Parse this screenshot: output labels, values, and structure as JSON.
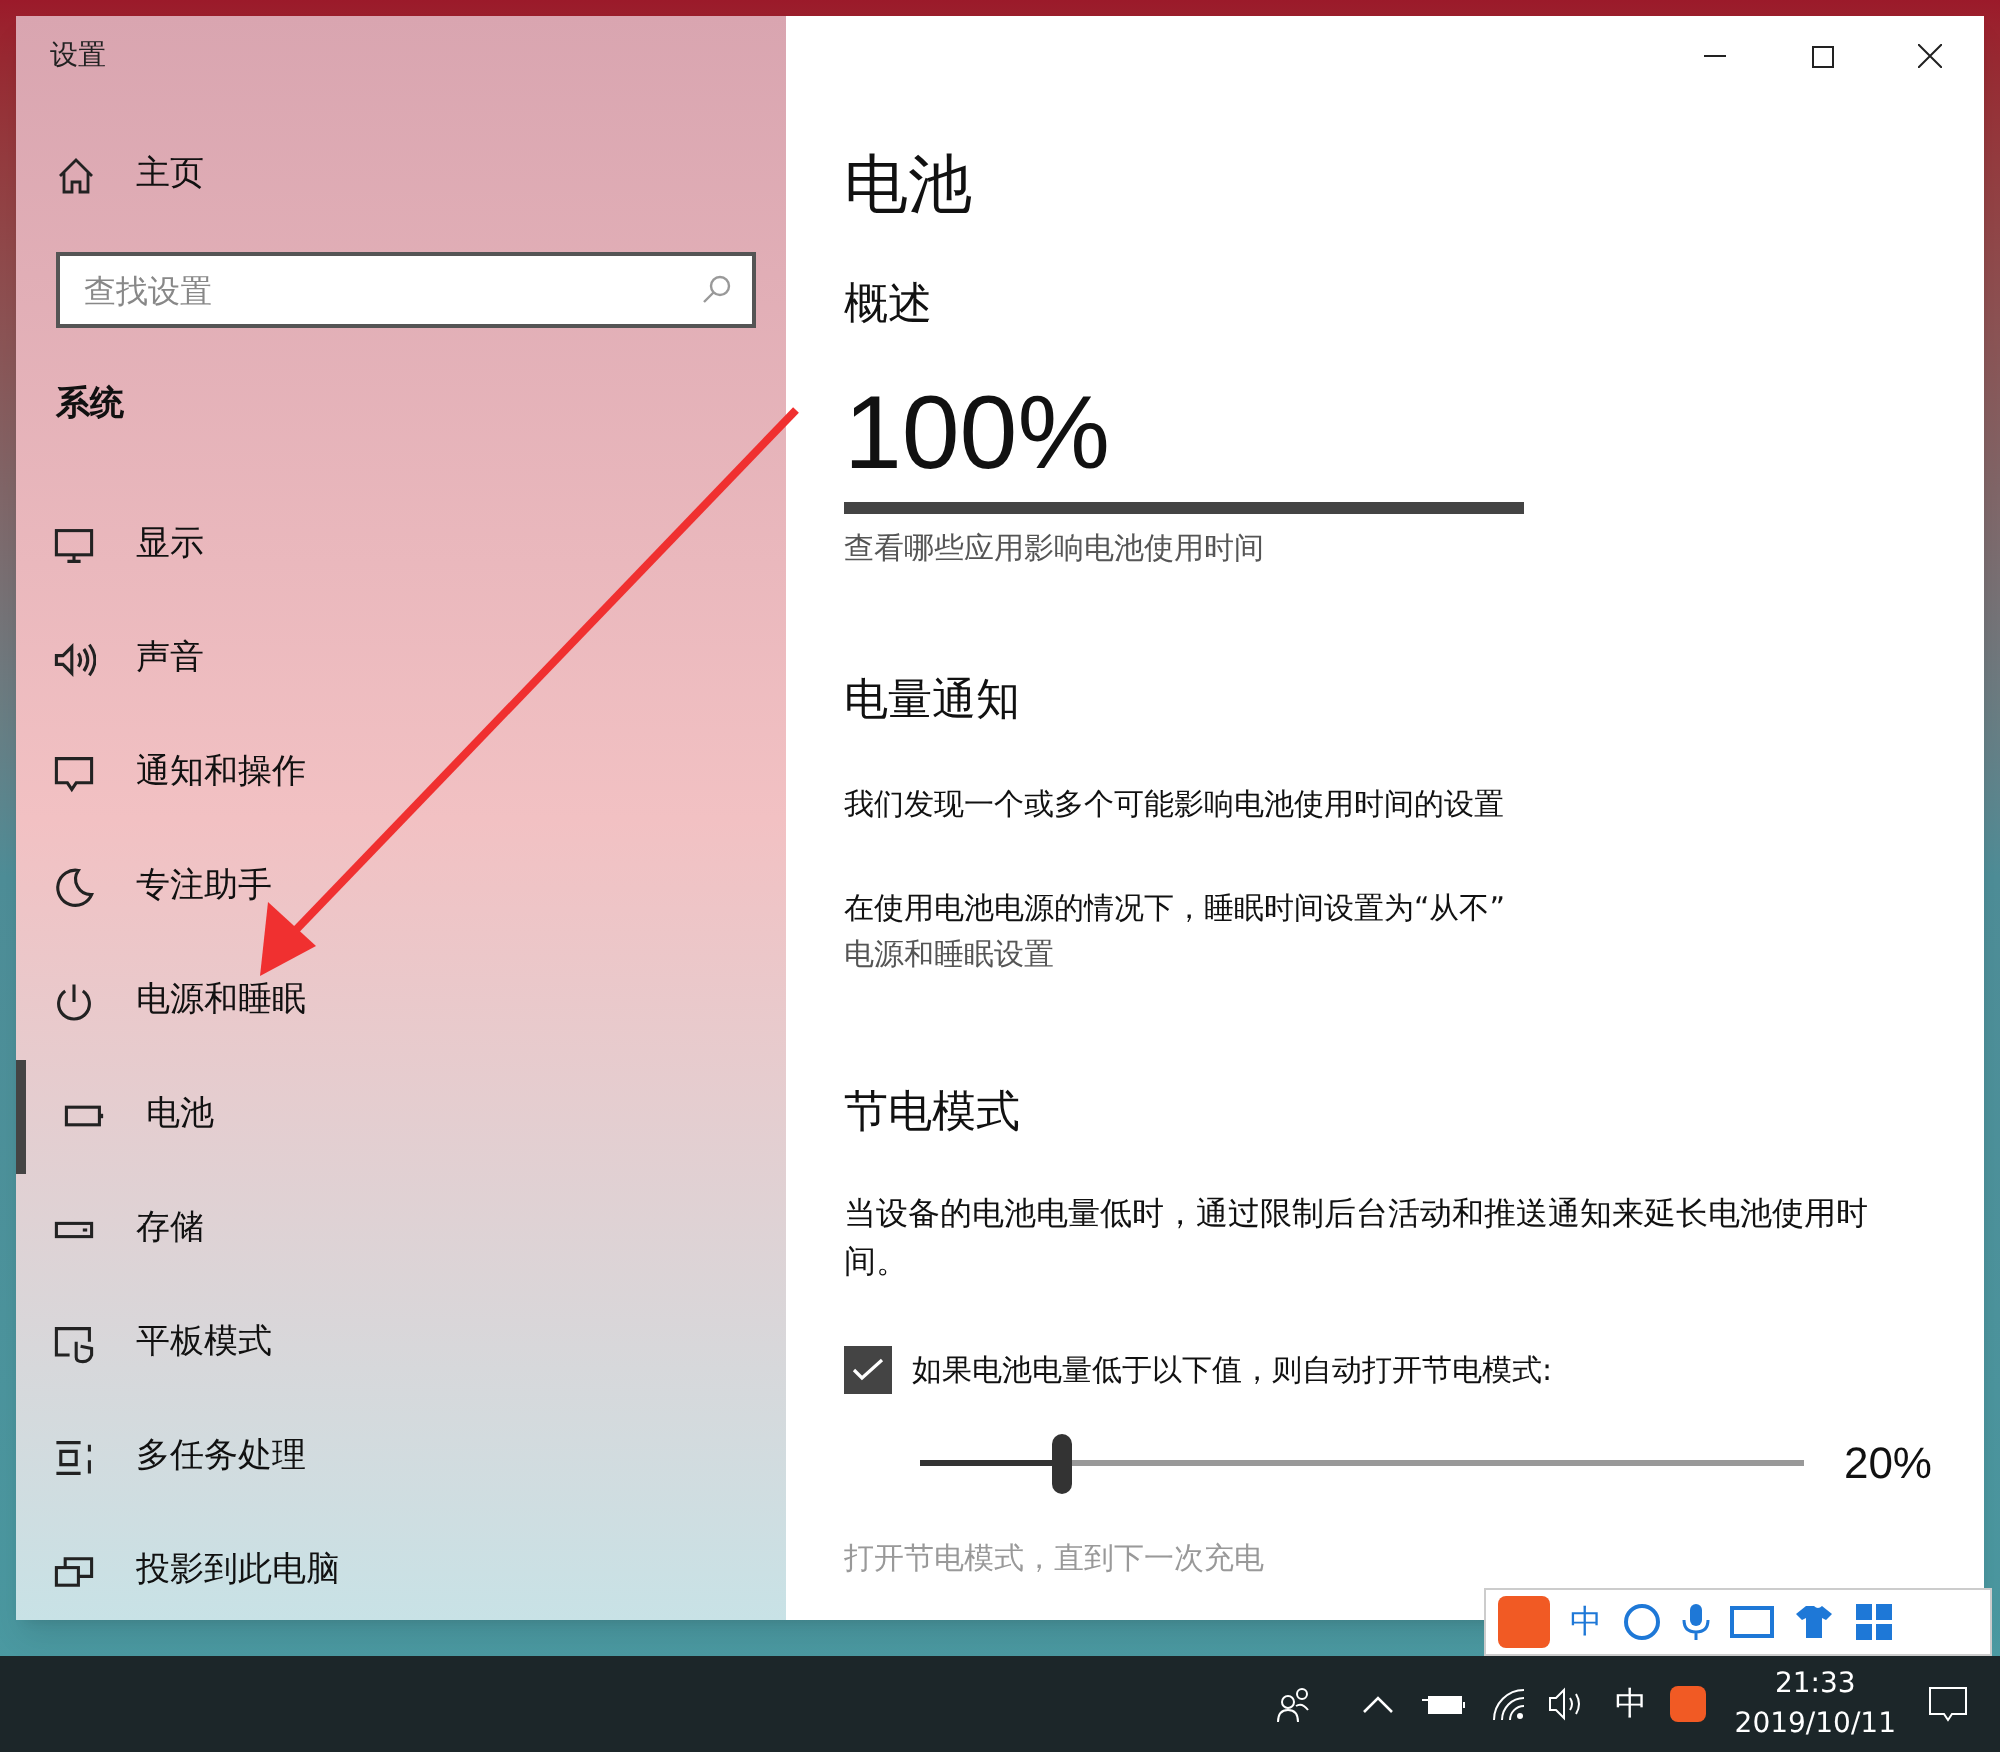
{
  "window": {
    "title": "设置"
  },
  "sidebar": {
    "home": "主页",
    "search": {
      "placeholder": "查找设置"
    },
    "section": "系统",
    "items": [
      {
        "label": "显示",
        "selected": false
      },
      {
        "label": "声音",
        "selected": false
      },
      {
        "label": "通知和操作",
        "selected": false
      },
      {
        "label": "专注助手",
        "selected": false
      },
      {
        "label": "电源和睡眠",
        "selected": false
      },
      {
        "label": "电池",
        "selected": true
      },
      {
        "label": "存储",
        "selected": false
      },
      {
        "label": "平板模式",
        "selected": false
      },
      {
        "label": "多任务处理",
        "selected": false
      },
      {
        "label": "投影到此电脑",
        "selected": false
      }
    ]
  },
  "content": {
    "title": "电池",
    "overview": {
      "heading": "概述",
      "percent": "100%",
      "level": 1,
      "link": "查看哪些应用影响电池使用时间"
    },
    "notifications": {
      "heading": "电量通知",
      "lines": [
        "我们发现一个或多个可能影响电池使用时间的设置",
        "在使用电池电源的情况下，睡眠时间设置为“从不”"
      ],
      "link": "电源和睡眠设置"
    },
    "saver": {
      "heading": "节电模式",
      "description": "当设备的电池电量低时，通过限制后台活动和推送通知来延长电池使用时间。",
      "checkbox": {
        "label": "如果电池电量低于以下值，则自动打开节电模式:",
        "checked": true
      },
      "slider": {
        "level": 0.16,
        "reading": "20%"
      },
      "toggle": {
        "label": "打开节电模式，直到下一次充电",
        "disabled": true
      }
    }
  },
  "ime_toolbar": {
    "mode": "中"
  },
  "taskbar": {
    "input_indicator": "中",
    "time": "21:33",
    "date": "2019/10/11"
  }
}
